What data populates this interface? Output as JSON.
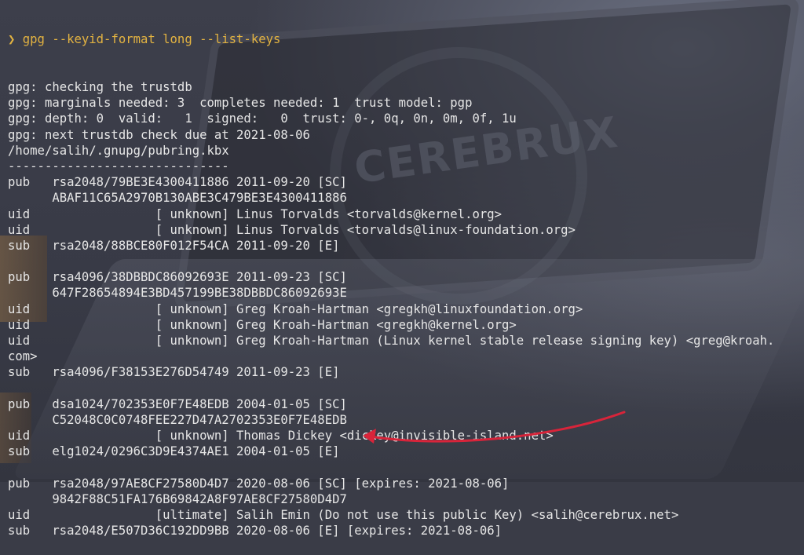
{
  "watermark": "CEREBRUX",
  "prompt": {
    "symbol": "❯",
    "command": " gpg --keyid-format long --list-keys"
  },
  "lines": [
    "gpg: checking the trustdb",
    "gpg: marginals needed: 3  completes needed: 1  trust model: pgp",
    "gpg: depth: 0  valid:   1  signed:   0  trust: 0-, 0q, 0n, 0m, 0f, 1u",
    "gpg: next trustdb check due at 2021-08-06",
    "/home/salih/.gnupg/pubring.kbx",
    "------------------------------",
    "pub   rsa2048/79BE3E4300411886 2011-09-20 [SC]",
    "      ABAF11C65A2970B130ABE3C479BE3E4300411886",
    "uid                 [ unknown] Linus Torvalds <torvalds@kernel.org>",
    "uid                 [ unknown] Linus Torvalds <torvalds@linux-foundation.org>",
    "sub   rsa2048/88BCE80F012F54CA 2011-09-20 [E]",
    "",
    "pub   rsa4096/38DBBDC86092693E 2011-09-23 [SC]",
    "      647F28654894E3BD457199BE38DBBDC86092693E",
    "uid                 [ unknown] Greg Kroah-Hartman <gregkh@linuxfoundation.org>",
    "uid                 [ unknown] Greg Kroah-Hartman <gregkh@kernel.org>",
    "uid                 [ unknown] Greg Kroah-Hartman (Linux kernel stable release signing key) <greg@kroah.",
    "com>",
    "sub   rsa4096/F38153E276D54749 2011-09-23 [E]",
    "",
    "pub   dsa1024/702353E0F7E48EDB 2004-01-05 [SC]",
    "      C52048C0C0748FEE227D47A2702353E0F7E48EDB",
    "uid                 [ unknown] Thomas Dickey <dickey@invisible-island.net>",
    "sub   elg1024/0296C3D9E4374AE1 2004-01-05 [E]",
    "",
    "pub   rsa2048/97AE8CF27580D4D7 2020-08-06 [SC] [expires: 2021-08-06]",
    "      9842F88C51FA176B69842A8F97AE8CF27580D4D7",
    "uid                 [ultimate] Salih Emin (Do not use this public Key) <salih@cerebrux.net>",
    "sub   rsa2048/E507D36C192DD9BB 2020-08-06 [E] [expires: 2021-08-06]"
  ],
  "colors": {
    "prompt": "#e3b341",
    "text": "#e6e6e6",
    "annotation_arrow": "#d8243a"
  }
}
